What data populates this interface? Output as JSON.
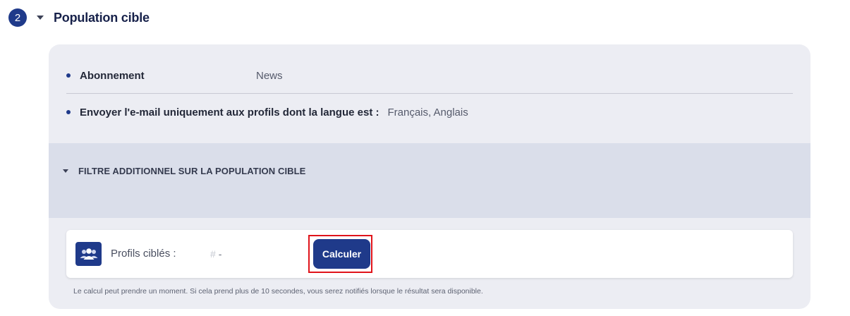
{
  "step": {
    "number": "2",
    "title": "Population cible"
  },
  "info": {
    "subscription_label": "Abonnement",
    "subscription_value": "News",
    "language_label": "Envoyer l'e-mail uniquement aux profils dont la langue est :",
    "language_value": "Français, Anglais"
  },
  "filter": {
    "label": "FILTRE ADDITIONNEL SUR LA POPULATION CIBLE"
  },
  "profiles": {
    "icon": "users-icon",
    "label": "Profils ciblés :",
    "hash": "#",
    "value": "-",
    "calculate_button": "Calculer",
    "note": "Le calcul peut prendre un moment. Si cela prend plus de 10 secondes, vous serez notifiés lorsque le résultat sera disponible."
  },
  "colors": {
    "primary": "#1f3a8a",
    "panel": "#ecedf3",
    "filter_band": "#dadeea",
    "highlight": "#e0141b"
  }
}
